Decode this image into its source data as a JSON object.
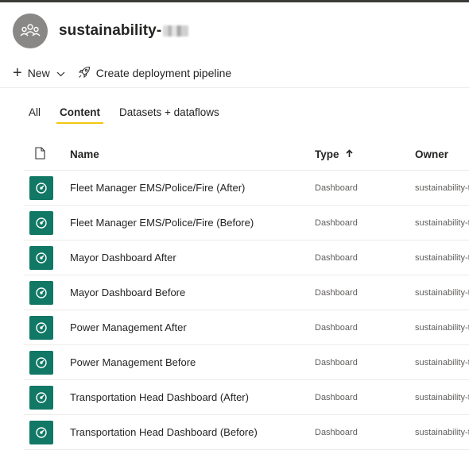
{
  "workspace": {
    "title": "sustainability-"
  },
  "toolbar": {
    "new_label": "New",
    "pipeline_label": "Create deployment pipeline"
  },
  "tabs": [
    {
      "label": "All",
      "active": false
    },
    {
      "label": "Content",
      "active": true
    },
    {
      "label": "Datasets + dataflows",
      "active": false
    }
  ],
  "table": {
    "headers": {
      "name": "Name",
      "type": "Type",
      "owner": "Owner"
    },
    "rows": [
      {
        "name": "Fleet Manager EMS/Police/Fire (After)",
        "type": "Dashboard",
        "owner": "sustainability-t"
      },
      {
        "name": "Fleet Manager EMS/Police/Fire (Before)",
        "type": "Dashboard",
        "owner": "sustainability-t"
      },
      {
        "name": "Mayor Dashboard After",
        "type": "Dashboard",
        "owner": "sustainability-t"
      },
      {
        "name": "Mayor Dashboard Before",
        "type": "Dashboard",
        "owner": "sustainability-t"
      },
      {
        "name": "Power Management After",
        "type": "Dashboard",
        "owner": "sustainability-t"
      },
      {
        "name": "Power Management Before",
        "type": "Dashboard",
        "owner": "sustainability-t"
      },
      {
        "name": "Transportation Head Dashboard (After)",
        "type": "Dashboard",
        "owner": "sustainability-t"
      },
      {
        "name": "Transportation Head Dashboard (Before)",
        "type": "Dashboard",
        "owner": "sustainability-t"
      }
    ]
  },
  "colors": {
    "accent_underline": "#f2c811",
    "dashboard_icon_bg": "#117865",
    "avatar_bg": "#8a8886"
  },
  "icons": {
    "workspace": "people-group-icon",
    "new": "plus-icon",
    "pipeline": "rocket-icon",
    "item": "dashboard-gauge-icon",
    "sort": "arrow-up-icon",
    "file": "document-icon"
  }
}
